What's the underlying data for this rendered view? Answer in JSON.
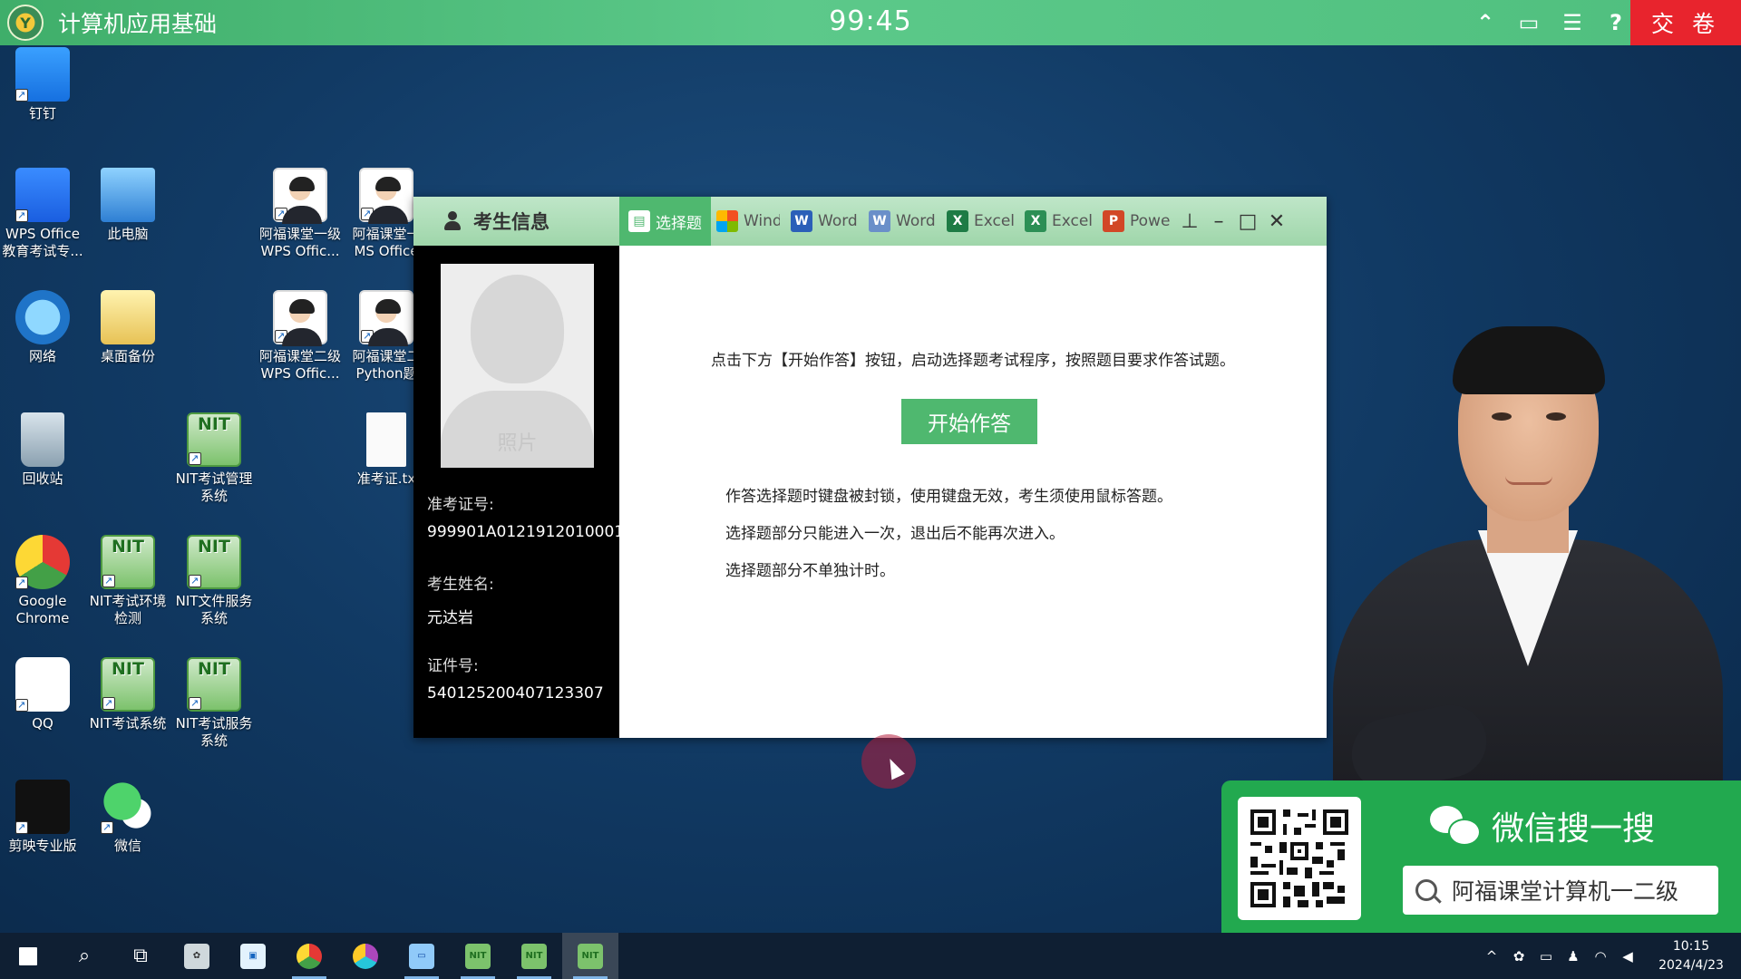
{
  "topbar": {
    "title": "计算机应用基础",
    "timer": "99:45",
    "submit_label": "交 卷",
    "icons": [
      "collapse-up-icon",
      "window-icon",
      "list-icon",
      "help-icon"
    ]
  },
  "desktop": {
    "icons": [
      {
        "label": "钉钉"
      },
      {
        "label": "WPS Office\n教育考试专..."
      },
      {
        "label": "此电脑"
      },
      {
        "label": "阿福课堂一级\nWPS Offic..."
      },
      {
        "label": "阿福课堂一\nMS Office"
      },
      {
        "label": "网络"
      },
      {
        "label": "桌面备份"
      },
      {
        "label": "阿福课堂二级\nWPS Offic..."
      },
      {
        "label": "阿福课堂二\nPython题"
      },
      {
        "label": "回收站"
      },
      {
        "label": "NIT考试管理\n系统"
      },
      {
        "label": "准考证.tx"
      },
      {
        "label": "Google\nChrome"
      },
      {
        "label": "NIT考试环境\n检测"
      },
      {
        "label": "NIT文件服务\n系统"
      },
      {
        "label": "QQ"
      },
      {
        "label": "NIT考试系统"
      },
      {
        "label": "NIT考试服务\n系统"
      },
      {
        "label": "剪映专业版"
      },
      {
        "label": "微信"
      }
    ]
  },
  "exam": {
    "sidebar_title": "考生信息",
    "photo_placeholder": "照片",
    "exam_id_label": "准考证号:",
    "exam_id": "999901A0121912010001",
    "name_label": "考生姓名:",
    "name": "元达岩",
    "cert_label": "证件号:",
    "cert_no": "540125200407123307",
    "tabs": [
      "选择题",
      "Wind",
      "Word",
      "Word",
      "Excel",
      "Excel",
      "Power"
    ],
    "instruction": "点击下方【开始作答】按钮，启动选择题考试程序，按照题目要求作答试题。",
    "start_label": "开始作答",
    "notes": [
      "作答选择题时键盘被封锁，使用键盘无效，考生须使用鼠标答题。",
      "选择题部分只能进入一次，退出后不能再次进入。",
      "选择题部分不单独计时。"
    ]
  },
  "wechat_ad": {
    "title": "微信搜一搜",
    "search_text": "阿福课堂计算机一二级"
  },
  "taskbar": {
    "time": "10:15",
    "date": "2024/4/23"
  },
  "colors": {
    "accent_green": "#4fb86f",
    "submit_red": "#e8242d",
    "wechat_green": "#22a94f"
  }
}
